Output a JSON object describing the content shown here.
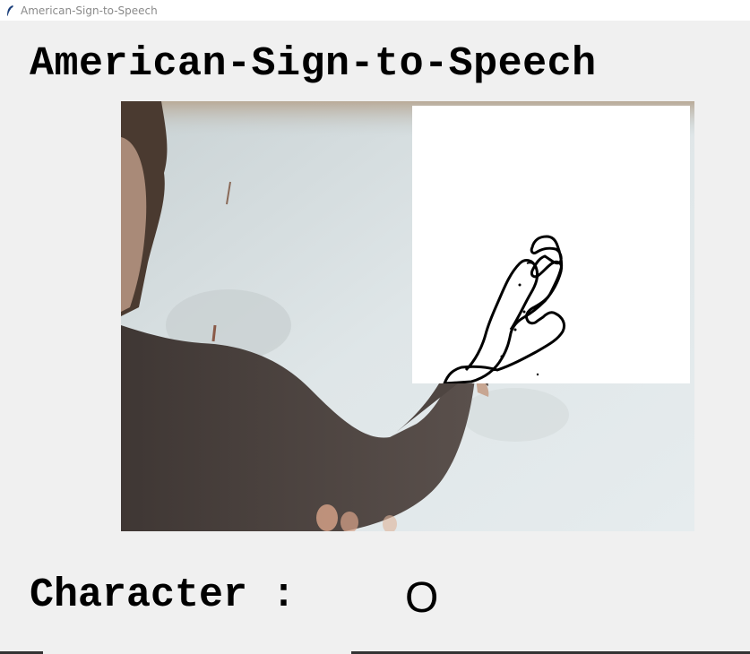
{
  "window": {
    "title": "American-Sign-to-Speech",
    "icon": "feather-icon"
  },
  "heading": "American-Sign-to-Speech",
  "camera": {
    "icon": "webcam-feed"
  },
  "result": {
    "label": "Character :",
    "value": "O"
  },
  "colors": {
    "background": "#f0f0f0",
    "text": "#000000",
    "roi_background": "#ffffff"
  }
}
